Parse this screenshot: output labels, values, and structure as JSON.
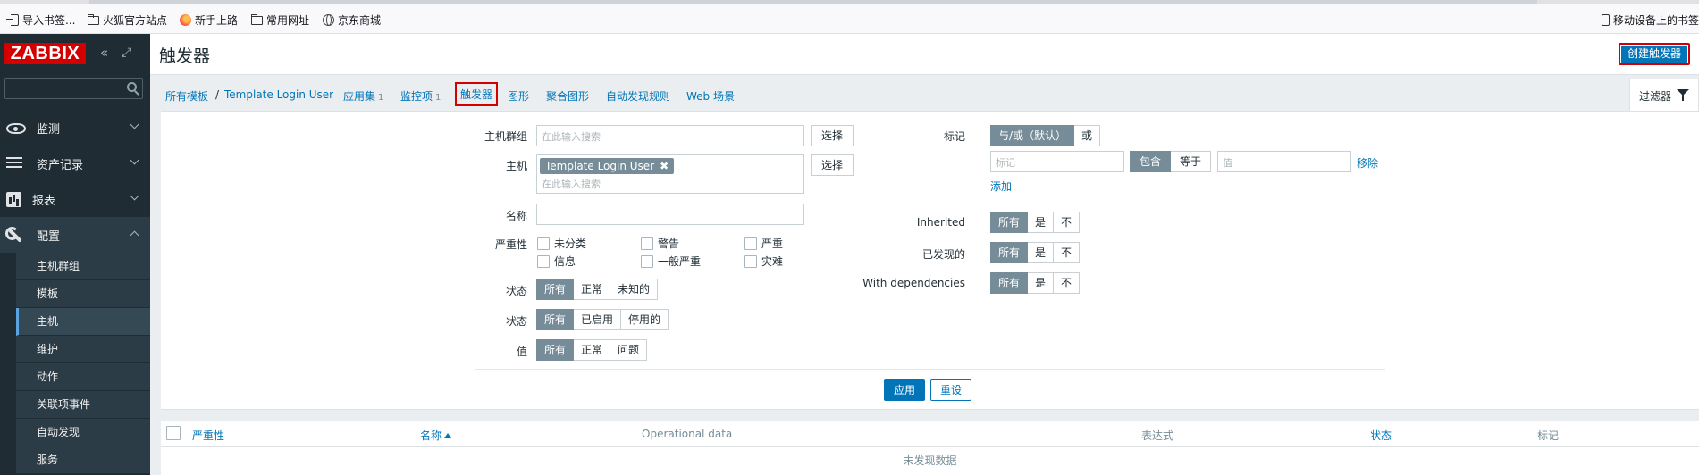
{
  "bookmarks": {
    "items": [
      {
        "label": "导入书签...",
        "icon": "import-icon"
      },
      {
        "label": "火狐官方站点",
        "icon": "folder-icon"
      },
      {
        "label": "新手上路",
        "icon": "firefox-icon"
      },
      {
        "label": "常用网址",
        "icon": "folder-icon"
      },
      {
        "label": "京东商城",
        "icon": "globe-icon"
      }
    ],
    "mobile": {
      "label": "移动设备上的书签",
      "icon": "phone-icon"
    }
  },
  "sidebar": {
    "logo": "ZABBIX",
    "collapse_icon": "«",
    "kiosk_icon": "⤢",
    "menu": [
      {
        "label": "监测",
        "icon": "eye-icon"
      },
      {
        "label": "资产记录",
        "icon": "list-icon"
      },
      {
        "label": "报表",
        "icon": "bar-chart-icon"
      },
      {
        "label": "配置",
        "icon": "wrench-icon"
      }
    ],
    "submenu": [
      "主机群组",
      "模板",
      "主机",
      "维护",
      "动作",
      "关联项事件",
      "自动发现",
      "服务"
    ],
    "selected_submenu": "主机"
  },
  "header": {
    "title": "触发器",
    "create_button": "创建触发器"
  },
  "breadcrumb": {
    "all_templates": "所有模板",
    "separator": "/",
    "template": "Template Login User",
    "tabs": [
      {
        "label": "应用集",
        "count": "1"
      },
      {
        "label": "监控项",
        "count": "1"
      },
      {
        "label": "触发器",
        "count": ""
      },
      {
        "label": "图形",
        "count": ""
      },
      {
        "label": "聚合图形",
        "count": ""
      },
      {
        "label": "自动发现规则",
        "count": ""
      },
      {
        "label": "Web 场景",
        "count": ""
      }
    ],
    "active_tab": "触发器",
    "filter_tab": "过滤器"
  },
  "filter": {
    "host_group_label": "主机群组",
    "host_group_placeholder": "在此输入搜索",
    "select_button": "选择",
    "host_label": "主机",
    "host_chip": "Template Login User",
    "host_chip_remove": "✖",
    "host_placeholder": "在此输入搜索",
    "name_label": "名称",
    "name_value": "",
    "severity_label": "严重性",
    "severities": [
      "未分类",
      "警告",
      "严重",
      "信息",
      "一般严重",
      "灾难"
    ],
    "state_label": "状态",
    "state_options": [
      "所有",
      "正常",
      "未知的"
    ],
    "status_label": "状态",
    "status_options": [
      "所有",
      "已启用",
      "停用的"
    ],
    "value_label": "值",
    "value_options": [
      "所有",
      "正常",
      "问题"
    ],
    "tags_label": "标记",
    "tags_mode": [
      "与/或（默认）",
      "或"
    ],
    "tag_placeholder": "标记",
    "tag_operators": [
      "包含",
      "等于"
    ],
    "tag_value_placeholder": "值",
    "remove_link": "移除",
    "add_link": "添加",
    "inherited_label": "Inherited",
    "discovered_label": "已发现的",
    "dependencies_label": "With dependencies",
    "tri_options": [
      "所有",
      "是",
      "不"
    ],
    "apply_button": "应用",
    "reset_button": "重设"
  },
  "table": {
    "columns": [
      {
        "label": "严重性",
        "sortable": true
      },
      {
        "label": "名称",
        "sortable": true,
        "sorted": "asc"
      },
      {
        "label": "Operational data",
        "sortable": false
      },
      {
        "label": "表达式",
        "sortable": false
      },
      {
        "label": "状态",
        "sortable": true
      },
      {
        "label": "标记",
        "sortable": false
      }
    ],
    "empty_message": "未发现数据"
  },
  "colors": {
    "sidebar_bg": "#1f2c33",
    "logo_red": "#d40000",
    "accent_blue": "#0275b8",
    "segment_active": "#768d99",
    "highlight_border": "#d40000"
  }
}
